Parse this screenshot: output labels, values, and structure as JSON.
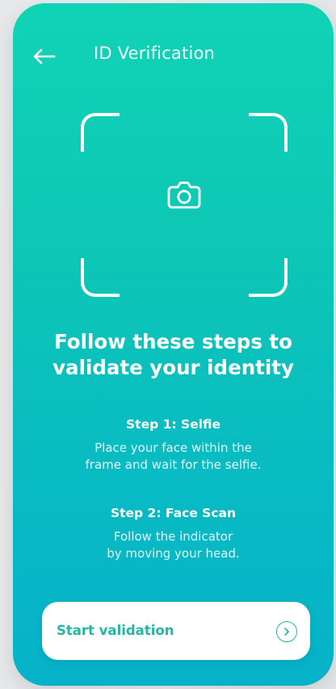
{
  "header": {
    "title": "ID Verification",
    "back_icon": "back-arrow-icon"
  },
  "capture": {
    "camera_icon": "camera-icon"
  },
  "headline": {
    "line1": "Follow these steps to",
    "line2": "validate your identity"
  },
  "steps": [
    {
      "title": "Step 1: Selfie",
      "line1": "Place your face within the",
      "line2": "frame and wait for the selfie."
    },
    {
      "title": "Step 2: Face Scan",
      "line1": "Follow the indicator",
      "line2": "by moving your head."
    }
  ],
  "cta": {
    "label": "Start validation",
    "icon": "chevron-right-icon"
  },
  "colors": {
    "background_top": "#10d3b6",
    "background_bottom": "#06b2ca",
    "cta_text": "#23b7a6",
    "white": "#ffffff"
  }
}
